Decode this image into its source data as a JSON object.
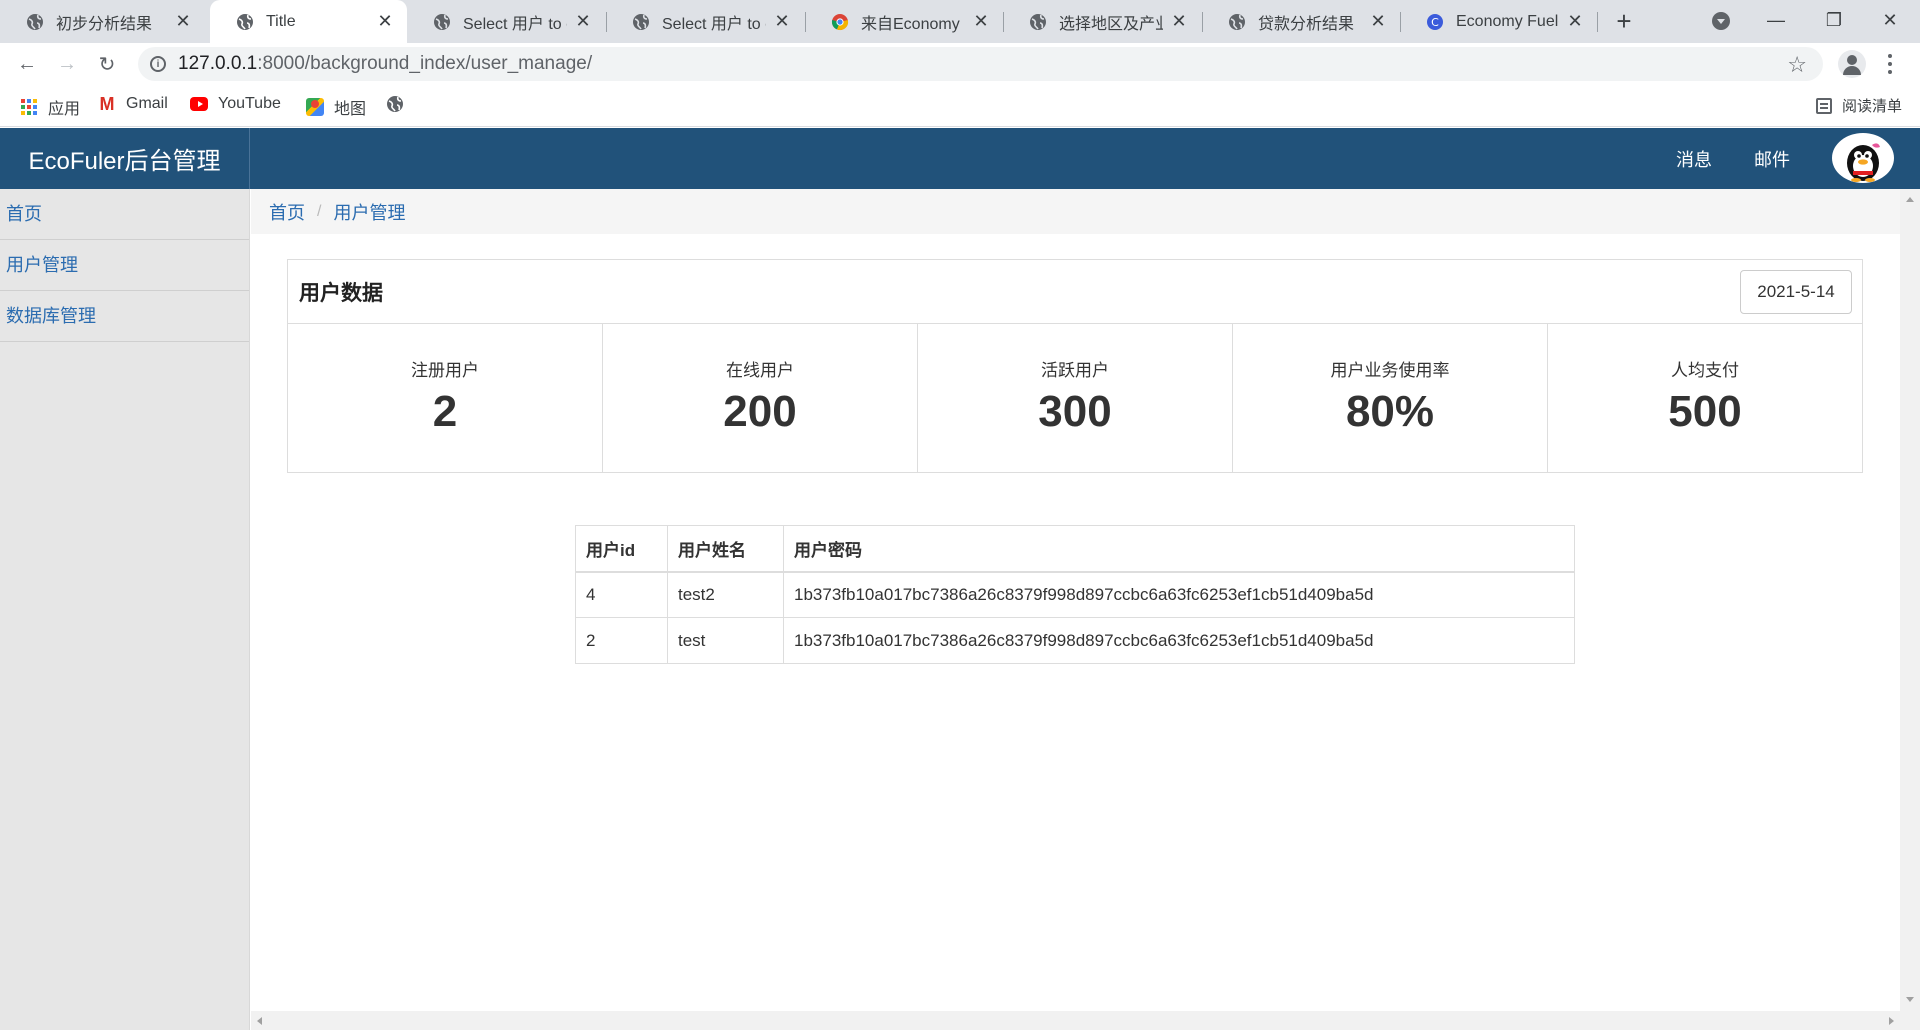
{
  "browser": {
    "tabs": [
      {
        "title": "初步分析结果",
        "icon": "globe-icon",
        "active": false
      },
      {
        "title": "Title",
        "icon": "globe-icon",
        "active": true
      },
      {
        "title": "Select 用户 to ch",
        "icon": "globe-icon",
        "active": false
      },
      {
        "title": "Select 用户 to ch",
        "icon": "globe-icon",
        "active": false
      },
      {
        "title": "来自Economy Fu",
        "icon": "chrome-icon",
        "active": false
      },
      {
        "title": "选择地区及产业",
        "icon": "globe-icon",
        "active": false
      },
      {
        "title": "贷款分析结果",
        "icon": "globe-icon",
        "active": false
      },
      {
        "title": "Economy Fueler",
        "icon": "c-letter-icon",
        "active": false
      }
    ],
    "url_host": "127.0.0.1",
    "url_path": ":8000/background_index/user_manage/",
    "bookmarks": [
      {
        "label": "应用",
        "icon": "apps-grid-icon"
      },
      {
        "label": "Gmail",
        "icon": "gmail-icon"
      },
      {
        "label": "YouTube",
        "icon": "youtube-icon"
      },
      {
        "label": "地图",
        "icon": "maps-icon"
      },
      {
        "label": "",
        "icon": "globe-icon"
      }
    ],
    "reading_list": "阅读清单"
  },
  "app": {
    "brand": "EcoFuler后台管理",
    "nav": {
      "messages": "消息",
      "mail": "邮件"
    },
    "sidebar": [
      {
        "label": "首页"
      },
      {
        "label": "用户管理"
      },
      {
        "label": "数据库管理"
      }
    ],
    "breadcrumb": [
      "首页",
      "用户管理"
    ],
    "panel": {
      "title": "用户数据",
      "date": "2021-5-14",
      "stats": [
        {
          "label": "注册用户",
          "value": "2"
        },
        {
          "label": "在线用户",
          "value": "200"
        },
        {
          "label": "活跃用户",
          "value": "300"
        },
        {
          "label": "用户业务使用率",
          "value": "80%"
        },
        {
          "label": "人均支付",
          "value": "500"
        }
      ]
    },
    "table": {
      "headers": [
        "用户id",
        "用户姓名",
        "用户密码"
      ],
      "rows": [
        [
          "4",
          "test2",
          "1b373fb10a017bc7386a26c8379f998d897ccbc6a63fc6253ef1cb51d409ba5d"
        ],
        [
          "2",
          "test",
          "1b373fb10a017bc7386a26c8379f998d897ccbc6a63fc6253ef1cb51d409ba5d"
        ]
      ]
    }
  },
  "colors": {
    "header_bg": "#21527a",
    "link": "#2b6cb0",
    "sidebar_bg": "#e6e6e6"
  }
}
